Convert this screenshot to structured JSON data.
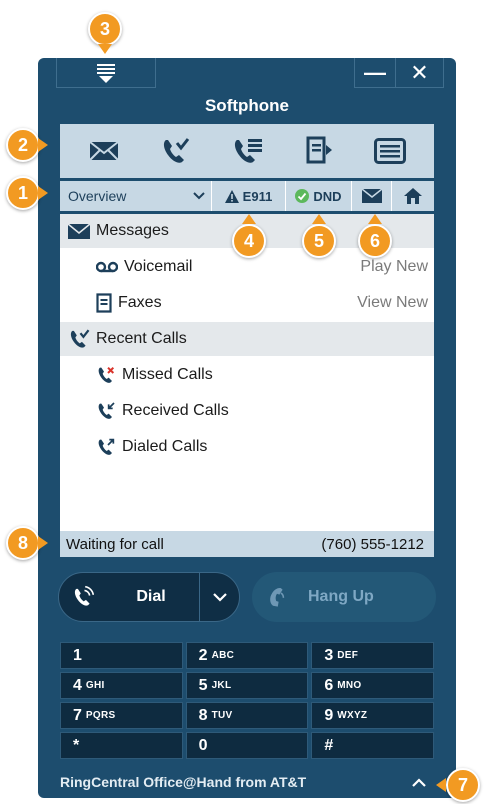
{
  "window": {
    "title": "Softphone",
    "minimize_label": "—",
    "close_label": "✕"
  },
  "toolbar": {
    "icons": [
      "messages-icon",
      "recent-calls-icon",
      "call-log-icon",
      "fax-icon",
      "list-icon"
    ]
  },
  "strip": {
    "view_select": "Overview",
    "e911_label": "E911",
    "dnd_label": "DND"
  },
  "content": {
    "messages_header": "Messages",
    "voicemail_label": "Voicemail",
    "voicemail_action": "Play New",
    "faxes_label": "Faxes",
    "faxes_action": "View New",
    "recent_calls_header": "Recent Calls",
    "missed_calls_label": "Missed Calls",
    "received_calls_label": "Received Calls",
    "dialed_calls_label": "Dialed Calls"
  },
  "status": {
    "text": "Waiting for call",
    "phone_number": "(760) 555-1212"
  },
  "call": {
    "dial_label": "Dial",
    "hangup_label": "Hang Up"
  },
  "keypad": {
    "keys": [
      {
        "num": "1",
        "letters": ""
      },
      {
        "num": "2",
        "letters": "ABC"
      },
      {
        "num": "3",
        "letters": "DEF"
      },
      {
        "num": "4",
        "letters": "GHI"
      },
      {
        "num": "5",
        "letters": "JKL"
      },
      {
        "num": "6",
        "letters": "MNO"
      },
      {
        "num": "7",
        "letters": "PQRS"
      },
      {
        "num": "8",
        "letters": "TUV"
      },
      {
        "num": "9",
        "letters": "WXYZ"
      },
      {
        "num": "*",
        "letters": ""
      },
      {
        "num": "0",
        "letters": ""
      },
      {
        "num": "#",
        "letters": ""
      }
    ]
  },
  "footer": {
    "brand": "RingCentral Office@Hand from AT&T"
  },
  "callouts": {
    "c1": "1",
    "c2": "2",
    "c3": "3",
    "c4": "4",
    "c5": "5",
    "c6": "6",
    "c7": "7",
    "c8": "8"
  },
  "colors": {
    "window_bg": "#1d4d6e",
    "panel_light": "#c7d8e4",
    "callout_orange": "#f29a22",
    "dnd_green": "#5cb85c"
  }
}
